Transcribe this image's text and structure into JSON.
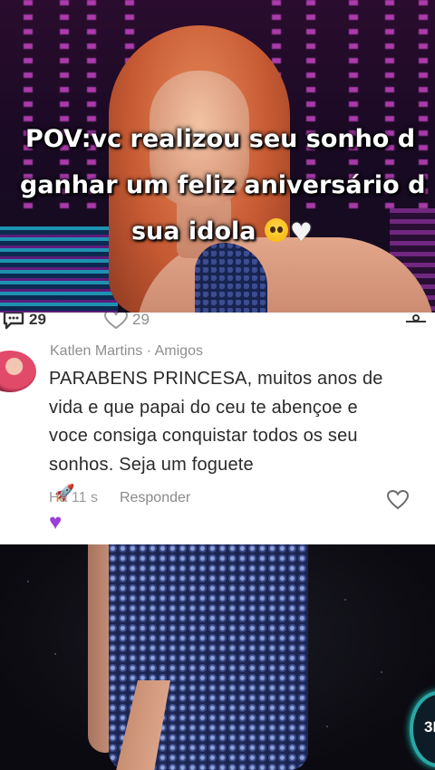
{
  "video_caption": {
    "line1": "POV:vc realizou seu sonho d",
    "line2": "ganhar um feliz aniversário d",
    "line3": "sua idola",
    "emojis": [
      "pleading-face",
      "white-heart"
    ]
  },
  "stats": {
    "replies": "29",
    "likes": "29"
  },
  "comment": {
    "username": "Katlen Martins",
    "separator": " · ",
    "relationship": "Amigos",
    "text_lines": [
      "PARABENS PRINCESA, muitos anos de",
      "vida e que papai do ceu te abençoe e",
      "voce consiga conquistar todos os seu",
      "sonhos. Seja um foguete"
    ],
    "emojis": [
      "rocket",
      "purple-heart"
    ],
    "time": "Há 11 s",
    "reply_label": "Responder"
  },
  "badge": {
    "text": "3I"
  },
  "colors": {
    "caption_text": "#ffffff",
    "comment_text": "#2a2a2a",
    "meta_text": "#9a9a9a",
    "purple_heart": "#9b3fd6",
    "badge_ring": "#2aa7a7"
  }
}
